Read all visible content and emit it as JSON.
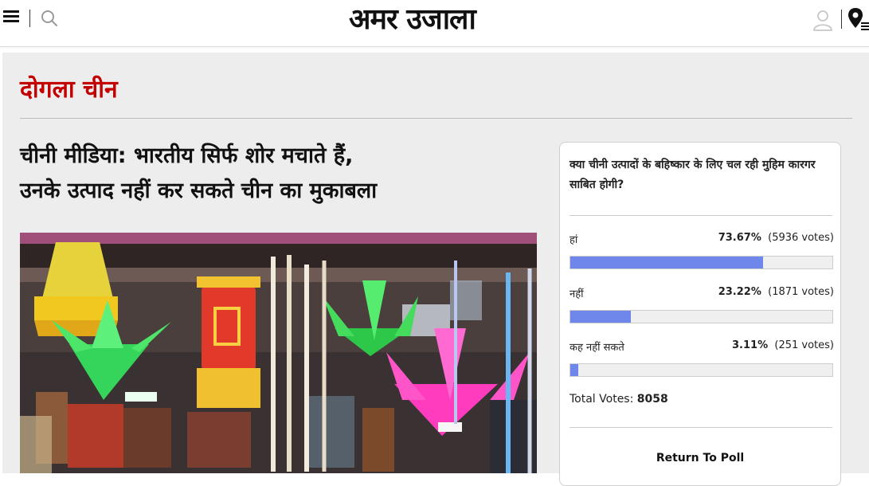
{
  "header": {
    "logo": "अमर उजाला"
  },
  "section": {
    "title": "दोगला चीन"
  },
  "article": {
    "headline_line1": "चीनी मीडिया: भारतीय सिर्फ शोर मचाते हैं,",
    "headline_line2": "उनके उत्पाद नहीं कर सकते चीन का मुकाबला"
  },
  "poll": {
    "question": "क्या चीनी उत्पादों के बहिष्कार के लिए चल रही मुहिम कारगर साबित होगी?",
    "options": [
      {
        "label": "हां",
        "percent": "73.67%",
        "votes": "(5936 votes)",
        "fraction": 0.7367
      },
      {
        "label": "नहीं",
        "percent": "23.22%",
        "votes": "(1871 votes)",
        "fraction": 0.2322
      },
      {
        "label": "कह नहीं सकते",
        "percent": "3.11%",
        "votes": "(251 votes)",
        "fraction": 0.0311
      }
    ],
    "total_label": "Total Votes:",
    "total_value": "8058",
    "return_label": "Return To Poll"
  },
  "colors": {
    "brand_red": "#c30000",
    "bar_fill": "#6f86ea"
  }
}
